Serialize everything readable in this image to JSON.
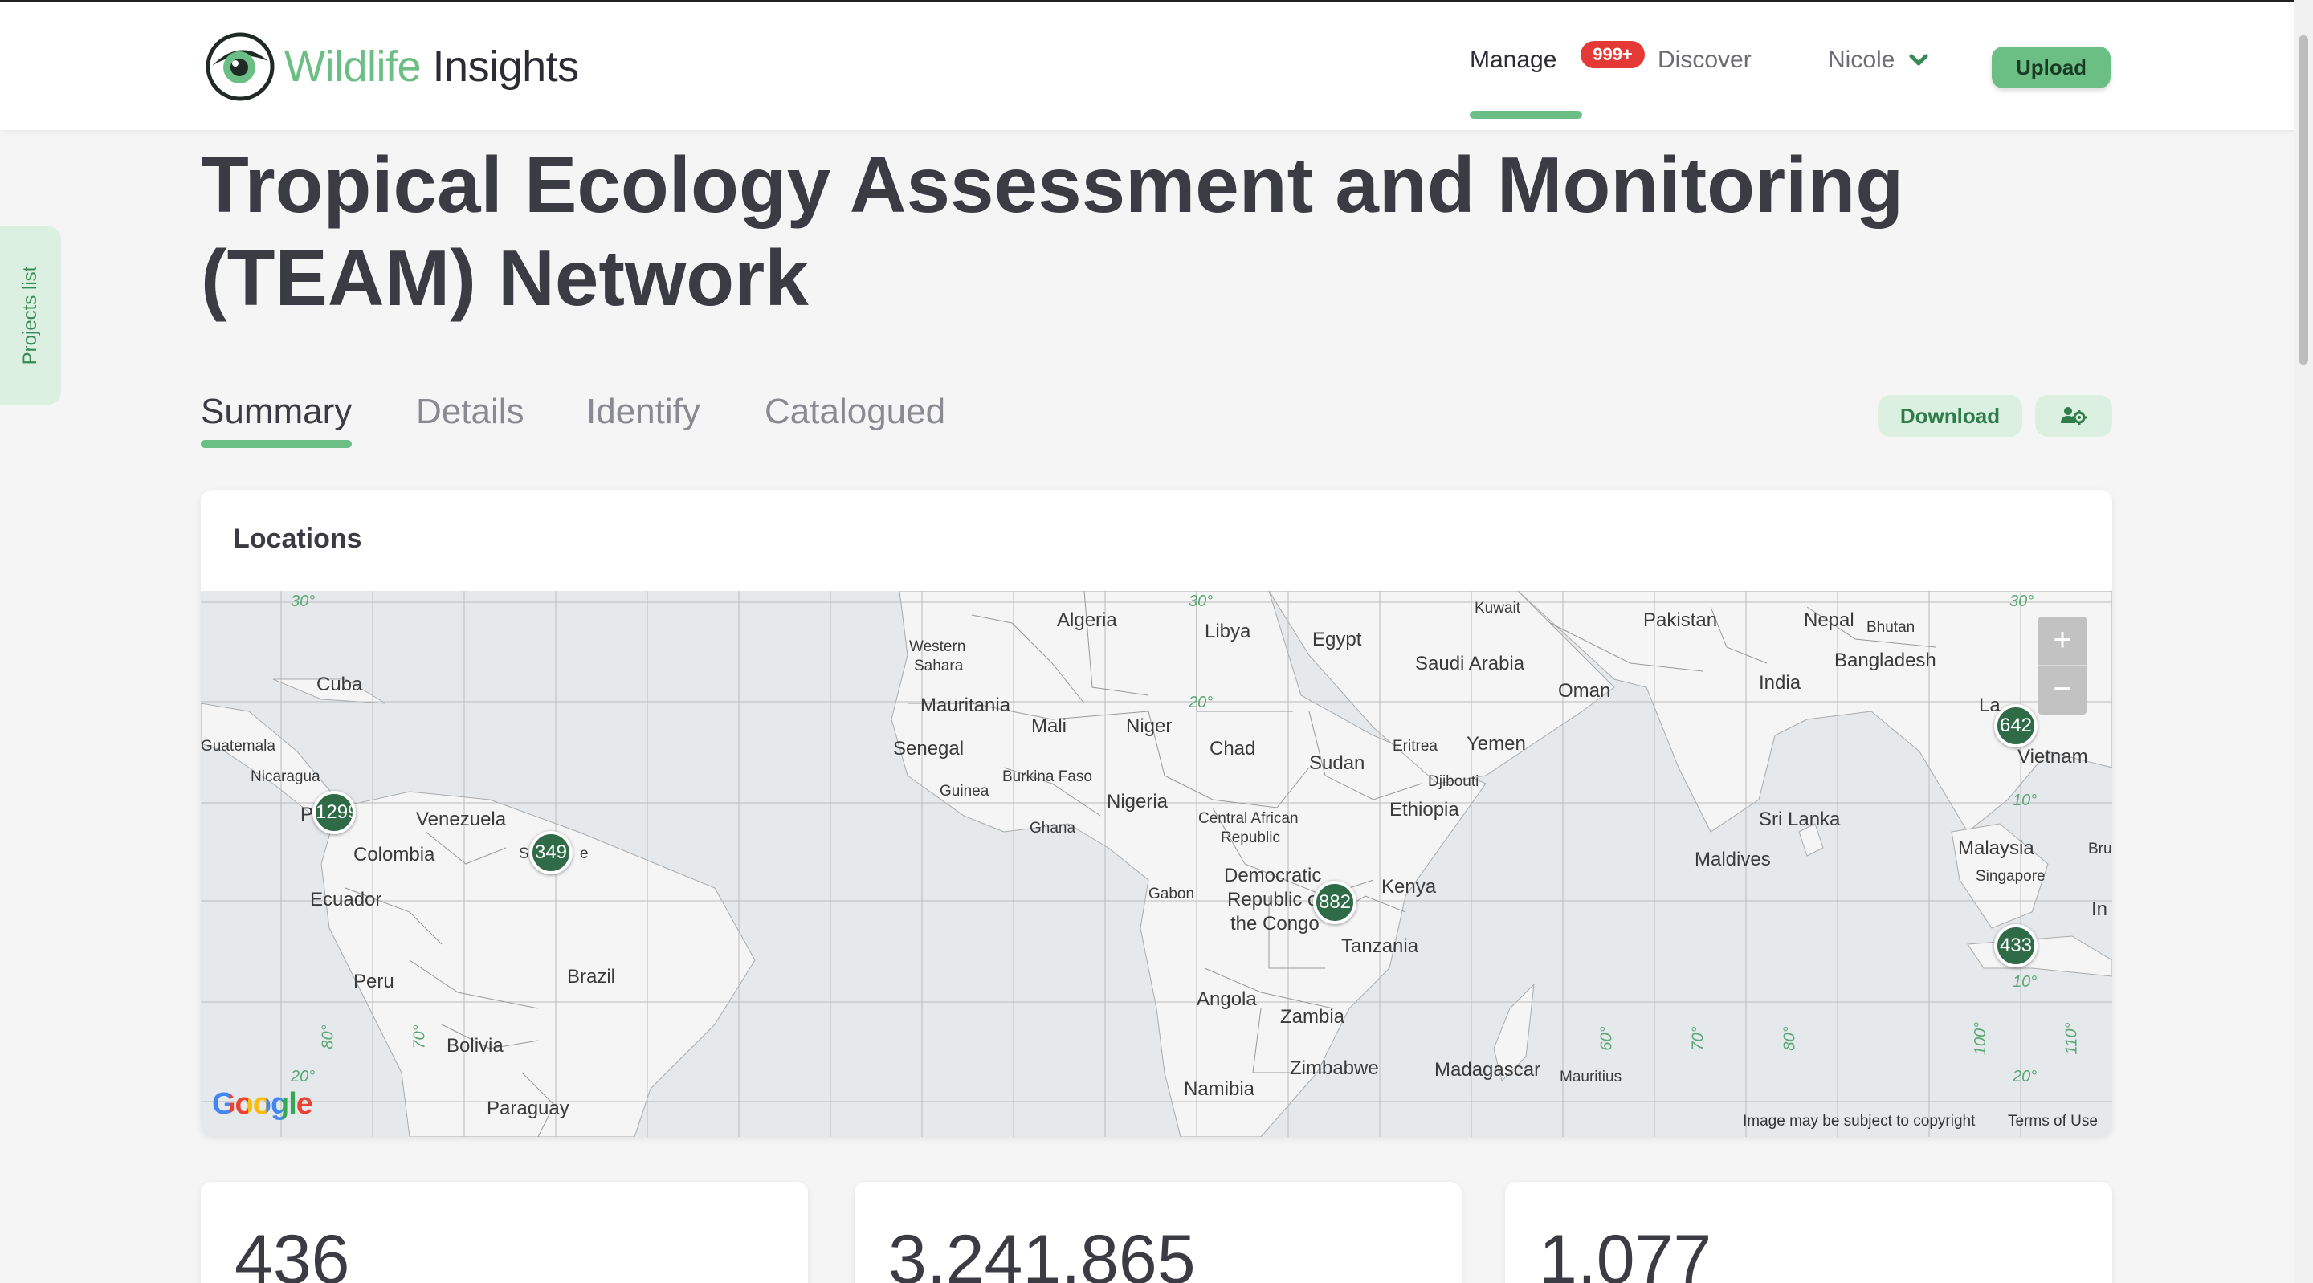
{
  "header": {
    "logo": {
      "word1": "Wildlife",
      "word2": "Insights",
      "icon": "eye-logo-icon"
    },
    "nav": {
      "manage": "Manage",
      "badge": "999+",
      "discover": "Discover",
      "user": "Nicole",
      "upload": "Upload"
    },
    "colors": {
      "brand_green": "#6cbf84",
      "badge_red": "#e53935"
    }
  },
  "sidebar_tab": {
    "label": "Projects list"
  },
  "project": {
    "title": "Tropical Ecology Assessment and Monitoring (TEAM) Network"
  },
  "tabs": [
    {
      "label": "Summary",
      "active": true
    },
    {
      "label": "Details",
      "active": false
    },
    {
      "label": "Identify",
      "active": false
    },
    {
      "label": "Catalogued",
      "active": false
    }
  ],
  "actions": {
    "download": "Download",
    "settings_icon": "users-gear-icon"
  },
  "locations": {
    "title": "Locations",
    "clusters": [
      "1299",
      "349",
      "882",
      "642",
      "433"
    ],
    "countries": {
      "algeria": "Algeria",
      "libya": "Libya",
      "egypt": "Egypt",
      "kuwait": "Kuwait",
      "pakistan": "Pakistan",
      "nepal": "Nepal",
      "bhutan": "Bhutan",
      "western_sahara_1": "Western",
      "western_sahara_2": "Sahara",
      "saudi_arabia": "Saudi Arabia",
      "bangladesh": "Bangladesh",
      "cuba": "Cuba",
      "mauritania": "Mauritania",
      "oman": "Oman",
      "india": "India",
      "mali": "Mali",
      "niger": "Niger",
      "la": "La",
      "guatemala": "Guatemala",
      "senegal": "Senegal",
      "chad": "Chad",
      "eritrea": "Eritrea",
      "yemen": "Yemen",
      "vietnam": "Vietnam",
      "nicaragua": "Nicaragua",
      "burkina_faso": "Burkina Faso",
      "sudan": "Sudan",
      "djibouti": "Djibouti",
      "guinea": "Guinea",
      "nigeria": "Nigeria",
      "venezuela": "Venezuela",
      "p": "P",
      "ethiopia": "Ethiopia",
      "ghana": "Ghana",
      "sri_lanka": "Sri Lanka",
      "car_1": "Central African",
      "car_2": "Republic",
      "colombia": "Colombia",
      "s": "S",
      "e": "e",
      "maldives": "Maldives",
      "malaysia": "Malaysia",
      "bru": "Bru",
      "drc_1": "Democratic",
      "drc_2": "Republic o",
      "drc_3": "the Congo",
      "kenya": "Kenya",
      "singapore": "Singapore",
      "gabon": "Gabon",
      "ecuador": "Ecuador",
      "in": "In",
      "tanzania": "Tanzania",
      "peru": "Peru",
      "brazil": "Brazil",
      "angola": "Angola",
      "zambia": "Zambia",
      "bolivia": "Bolivia",
      "zimbabwe": "Zimbabwe",
      "madagascar": "Madagascar",
      "mauritius": "Mauritius",
      "namibia": "Namibia",
      "paraguay": "Paraguay"
    },
    "graticule": {
      "lat_30": "30°",
      "lat_20": "20°",
      "lat_10": "10°",
      "lon_80": "80°",
      "lon_70": "70°",
      "lon_60": "60°",
      "lon_100": "100°",
      "lon_110": "110°"
    },
    "zoom_in": "+",
    "zoom_out": "−",
    "google": "Google",
    "copyright": "Image may be subject to copyright",
    "terms": "Terms of Use"
  },
  "stats": [
    {
      "value": "436"
    },
    {
      "value": "3,241,865"
    },
    {
      "value": "1,077"
    }
  ]
}
